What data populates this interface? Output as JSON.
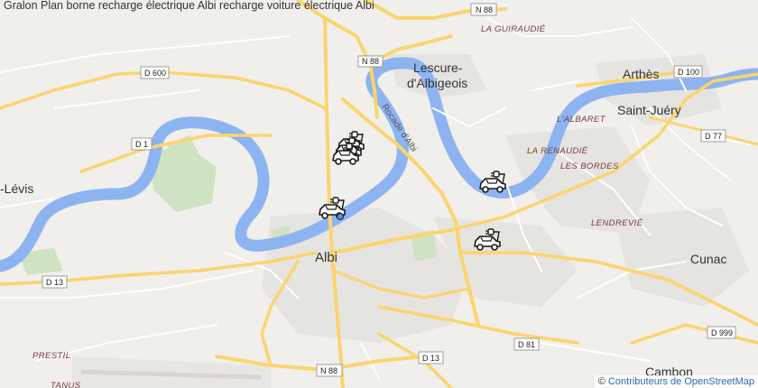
{
  "page": {
    "title": "Gralon Plan borne recharge électrique Albi recharge voiture électrique Albi"
  },
  "attribution": {
    "prefix": "© ",
    "link_text": "Contributeurs de OpenStreetMap"
  },
  "colors": {
    "river": "#8db4f0",
    "major_road": "#fbd46e",
    "minor_road": "#ffffff",
    "background": "#f0efec",
    "marker": "#1a1a1a"
  },
  "places": {
    "albi": "Albi",
    "lescure_1": "Lescure-",
    "lescure_2": "d'Albigeois",
    "arthes": "Arthès",
    "saint_juery": "Saint-Juéry",
    "cunac": "Cunac",
    "cambon": "Cambon",
    "levis": "-Lévis"
  },
  "localities": {
    "la_guiraudie": "LA GUIRAUDIÉ",
    "l_albaret": "L'ALBARET",
    "la_renaudie": "LA RENAUDIÉ",
    "les_bordes": "LES BORDES",
    "lendrevie": "LENDREVIÉ",
    "prestil": "PRESTIL",
    "tanus": "TANUS"
  },
  "streets": {
    "rocade": "Rocade d'Albi"
  },
  "road_shields": {
    "n88_top": "N 88",
    "n88_mid": "N 88",
    "d600": "D 600",
    "d1": "D 1",
    "d100": "D 100",
    "d77": "D 77",
    "d13_left": "D 13",
    "d13_bottom": "D 13",
    "d81": "D 81",
    "d999": "D 999",
    "n88_bottom": "N 88"
  },
  "markers": {
    "count": 7,
    "icon": "ev-charging-car-icon"
  }
}
